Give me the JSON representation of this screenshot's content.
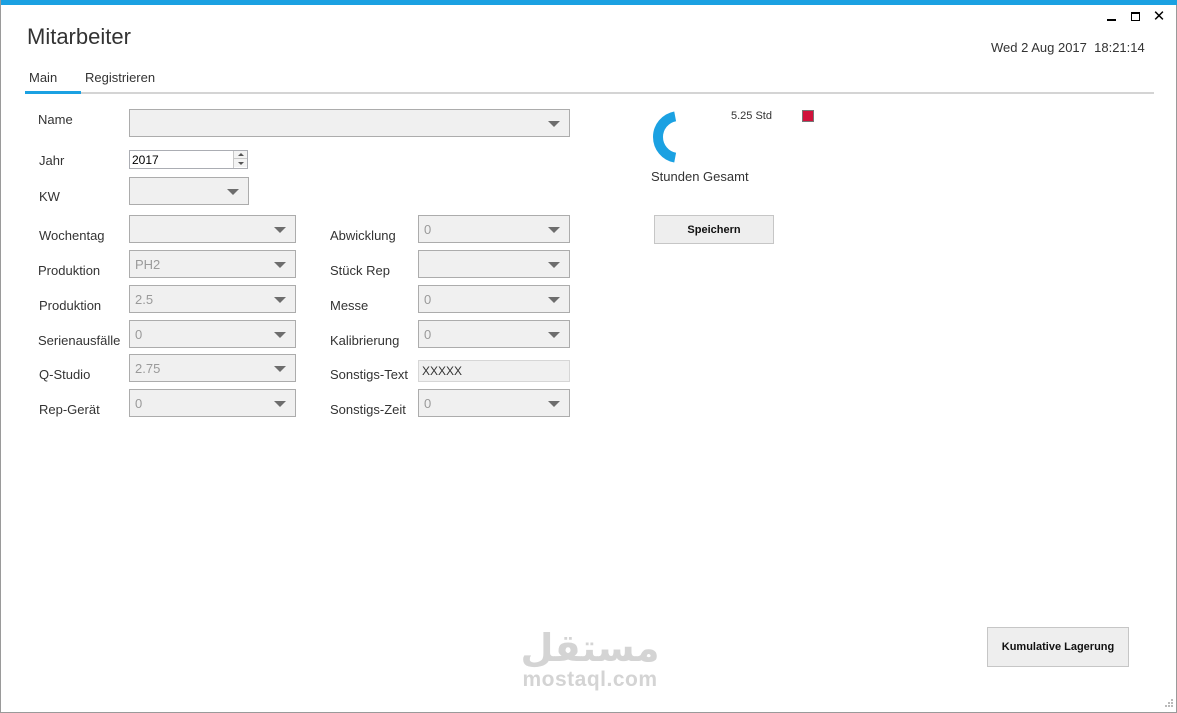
{
  "window": {
    "title": "Mitarbeiter",
    "datetime": "Wed 2 Aug 2017  18:21:14",
    "controls": {
      "minimize": "minimize",
      "maximize": "maximize",
      "close": "✕"
    }
  },
  "tabs": [
    {
      "label": "Main",
      "active": true
    },
    {
      "label": "Registrieren",
      "active": false
    }
  ],
  "form": {
    "name": {
      "label": "Name",
      "value": ""
    },
    "jahr": {
      "label": "Jahr",
      "value": "2017"
    },
    "kw": {
      "label": "KW",
      "value": ""
    },
    "left": [
      {
        "label": "Wochentag",
        "value": ""
      },
      {
        "label": "Produktion",
        "value": "PH2"
      },
      {
        "label": "Produktion",
        "value": "2.5"
      },
      {
        "label": "Serienausfälle",
        "value": "0"
      },
      {
        "label": "Q-Studio",
        "value": "2.75"
      },
      {
        "label": "Rep-Gerät",
        "value": "0"
      }
    ],
    "right": [
      {
        "label": "Abwicklung",
        "value": "0"
      },
      {
        "label": "Stück Rep",
        "value": ""
      },
      {
        "label": "Messe",
        "value": "0"
      },
      {
        "label": "Kalibrierung",
        "value": "0"
      },
      {
        "label": "Sonstigs-Text",
        "value": "XXXXX"
      },
      {
        "label": "Sonstigs-Zeit",
        "value": "0"
      }
    ]
  },
  "summary": {
    "hours": "5.25 Std",
    "label": "Stunden Gesamt",
    "ring_fraction": 0.33,
    "ring_color": "#1ba1e2",
    "legend_color": "#d0123b"
  },
  "buttons": {
    "save": "Speichern",
    "kumulative": "Kumulative Lagerung"
  },
  "watermark": {
    "logo": "مستقل",
    "url": "mostaql.com"
  }
}
